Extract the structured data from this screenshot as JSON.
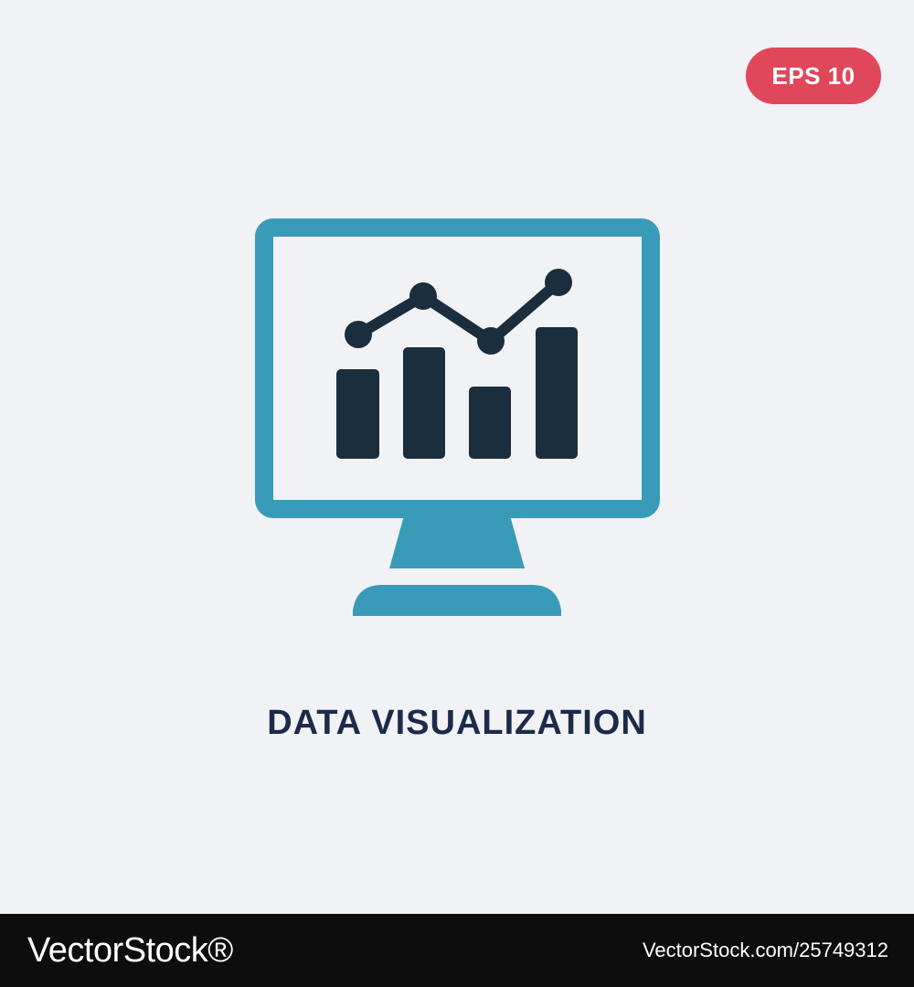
{
  "badge": {
    "label": "EPS 10",
    "color": "#e0475a"
  },
  "icon": {
    "name": "data-visualization-monitor-icon",
    "primary_color": "#3a9bb8",
    "secondary_color": "#1a2e3d"
  },
  "caption": {
    "text": "DATA VISUALIZATION",
    "color": "#1c2b4a"
  },
  "footer": {
    "logo_text": "VectorStock®",
    "id_text": "VectorStock.com/25749312",
    "background": "#0d0d0d"
  },
  "colors": {
    "background": "#f1f2f5"
  }
}
